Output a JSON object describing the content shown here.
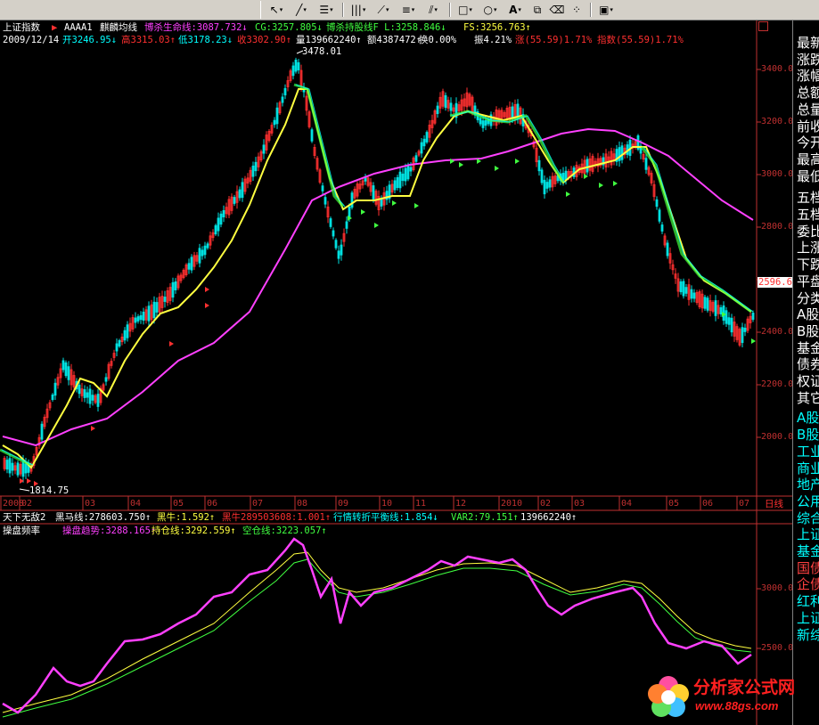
{
  "toolbar": {
    "buttons": [
      "pointer-icon",
      "line-icon",
      "text-lines-icon",
      "vertical-lines-icon",
      "fan-icon",
      "parallel-lines-icon",
      "diagonal-lines-icon",
      "rectangle-icon",
      "ellipse-icon",
      "text-A-icon",
      "copy-icon",
      "eraser-icon",
      "palette-icon",
      "save-icon"
    ]
  },
  "main_chart": {
    "title": "上证指数",
    "formula": "AAAA1",
    "formula_name": "麒麟均线",
    "ind1": "博杀生命线:3087.732↓",
    "ind2": "CG:3257.805↓",
    "ind3": "博杀持股线F L:3258.846↓",
    "ind4": "FS:3256.763↑",
    "date": "2009/12/14",
    "open": "开3246.95↓",
    "high": "高3315.03↑",
    "low": "低3178.23↓",
    "close": "收3302.90↑",
    "volume": "量139662240↑",
    "amount": "额4387472↑",
    "turnover": "换0.00%",
    "amplitude": "振4.21%",
    "change": "涨(55.59)1.71%",
    "index_change": "指数(55.59)1.71%",
    "high_mark": "3478.01",
    "low_mark": "1814.75",
    "current_price": "2596.6"
  },
  "y_axis": [
    "3400.0",
    "3200.0",
    "3000.0",
    "2800.0",
    "2600.0",
    "2400.0",
    "2200.0",
    "2000.0"
  ],
  "x_axis": [
    "2008",
    "02",
    "03",
    "04",
    "05",
    "06",
    "07",
    "08",
    "09",
    "10",
    "11",
    "12",
    "2010",
    "02",
    "03",
    "04",
    "05",
    "06",
    "07"
  ],
  "period": "日线",
  "sub1": {
    "name": "天下无敌2",
    "l1": "黑马线:278603.750↑",
    "l2": "黑牛:1.592↑",
    "l3": "黑牛289503608:1.001↑",
    "l4": "行情转折平衡线:1.854↓",
    "l5": "VAR2:79.151↑",
    "l6": "139662240↑"
  },
  "sub2": {
    "name": "操盘频率",
    "l1": "操盘趋势:3288.165↑",
    "l2": "持仓线:3292.559↑",
    "l3": "空仓线:3223.057↑",
    "y1": "3000.0",
    "y2": "2500.0"
  },
  "right_panel": [
    {
      "t": "最新",
      "c": "#ffffff"
    },
    {
      "t": "涨跌",
      "c": "#ffffff"
    },
    {
      "t": "涨幅",
      "c": "#ffffff"
    },
    {
      "t": "总额",
      "c": "#ffffff"
    },
    {
      "t": "总量",
      "c": "#ffffff"
    },
    {
      "t": "前收",
      "c": "#ffffff"
    },
    {
      "t": "今开",
      "c": "#ffffff"
    },
    {
      "t": "最高",
      "c": "#ffffff"
    },
    {
      "t": "最低",
      "c": "#ffffff"
    },
    {
      "t": "五档",
      "c": "#ffffff"
    },
    {
      "t": "五档",
      "c": "#ffffff"
    },
    {
      "t": "委比",
      "c": "#ffffff"
    },
    {
      "t": "上涨",
      "c": "#ffffff"
    },
    {
      "t": "下跌",
      "c": "#ffffff"
    },
    {
      "t": "平盘",
      "c": "#ffffff"
    },
    {
      "t": "分类",
      "c": "#ffffff"
    },
    {
      "t": "A股",
      "c": "#ffffff"
    },
    {
      "t": "B股",
      "c": "#ffffff"
    },
    {
      "t": "基金",
      "c": "#ffffff"
    },
    {
      "t": "债券",
      "c": "#ffffff"
    },
    {
      "t": "权证",
      "c": "#ffffff"
    },
    {
      "t": "其它",
      "c": "#ffffff"
    },
    {
      "t": "A股",
      "c": "#00ffff"
    },
    {
      "t": "B股",
      "c": "#00ffff"
    },
    {
      "t": "工业",
      "c": "#00ffff"
    },
    {
      "t": "商业",
      "c": "#00ffff"
    },
    {
      "t": "地产",
      "c": "#00ffff"
    },
    {
      "t": "公用",
      "c": "#00ffff"
    },
    {
      "t": "综合",
      "c": "#00ffff"
    },
    {
      "t": "上证",
      "c": "#00ffff"
    },
    {
      "t": "基金",
      "c": "#00ffff"
    },
    {
      "t": "国债",
      "c": "#ff4040"
    },
    {
      "t": "企债",
      "c": "#ff4040"
    },
    {
      "t": "红利",
      "c": "#00ffff"
    },
    {
      "t": "上证",
      "c": "#00ffff"
    },
    {
      "t": "新综",
      "c": "#00ffff"
    }
  ],
  "watermark": {
    "line1": "分析家公式网",
    "line2": "www.88gs.com"
  },
  "colors": {
    "up": "#ff3030",
    "down": "#00ffff",
    "life": "#ff40ff",
    "yellow": "#ffff40",
    "green": "#40ff40"
  }
}
